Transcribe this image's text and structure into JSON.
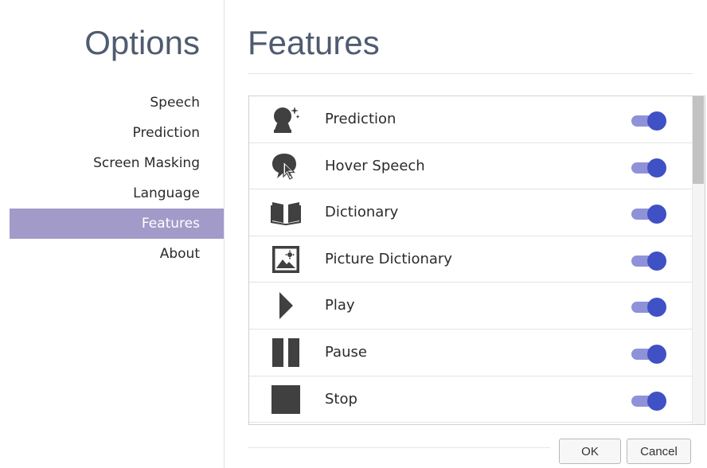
{
  "sidebar": {
    "title": "Options",
    "items": [
      {
        "label": "Speech",
        "active": false
      },
      {
        "label": "Prediction",
        "active": false
      },
      {
        "label": "Screen Masking",
        "active": false
      },
      {
        "label": "Language",
        "active": false
      },
      {
        "label": "Features",
        "active": true
      },
      {
        "label": "About",
        "active": false
      }
    ]
  },
  "main": {
    "title": "Features",
    "features": [
      {
        "label": "Prediction",
        "icon": "crystal-ball-icon",
        "enabled": true
      },
      {
        "label": "Hover Speech",
        "icon": "speech-bubble-cursor-icon",
        "enabled": true
      },
      {
        "label": "Dictionary",
        "icon": "book-icon",
        "enabled": true
      },
      {
        "label": "Picture Dictionary",
        "icon": "picture-icon",
        "enabled": true
      },
      {
        "label": "Play",
        "icon": "play-icon",
        "enabled": true
      },
      {
        "label": "Pause",
        "icon": "pause-icon",
        "enabled": true
      },
      {
        "label": "Stop",
        "icon": "stop-icon",
        "enabled": true
      }
    ]
  },
  "buttons": {
    "ok_label": "OK",
    "cancel_label": "Cancel"
  },
  "colors": {
    "active_nav": "#a29bc9",
    "title": "#4f5b70",
    "toggle_knob": "#3f51c4",
    "toggle_track": "#8f92d8",
    "icon": "#404040"
  }
}
